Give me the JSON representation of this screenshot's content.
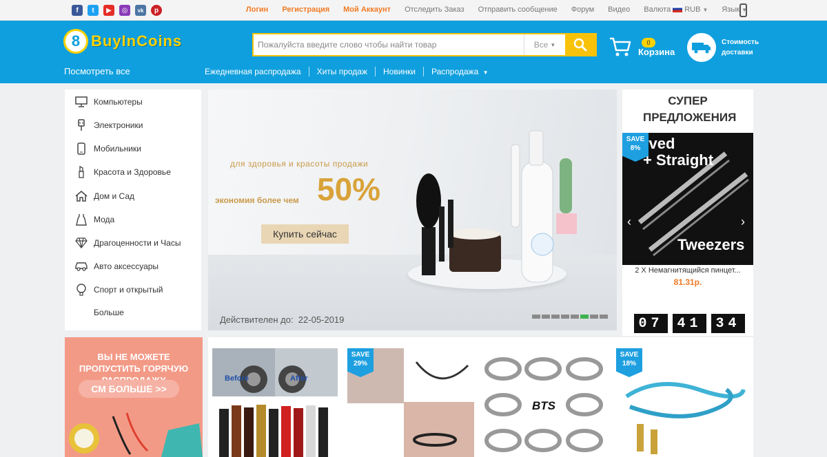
{
  "social": [
    "f",
    "t",
    "▶",
    "◎",
    "vk",
    "p"
  ],
  "topbar": {
    "login": "Логин",
    "register": "Регистрация",
    "account": "Мой Аккаунт",
    "track": "Отследить Заказ",
    "message": "Отправить сообщение",
    "forum": "Форум",
    "video": "Видео",
    "currency_label": "Валюта",
    "currency_value": "RUB",
    "language": "Язык"
  },
  "header": {
    "logo_mark": "8",
    "logo_text": "BuyInCoins",
    "search_placeholder": "Пожалуйста введите слово чтобы найти товар",
    "search_category": "Все",
    "cart_count": "0",
    "cart_label": "Корзина",
    "shipping_label": "Стоимость доставки",
    "view_all": "Посмотреть все"
  },
  "nav": [
    "Ежедневная распродажа",
    "Хиты продаж",
    "Новинки",
    "Распродажа"
  ],
  "categories": [
    {
      "label": "Компьютеры",
      "icon": "monitor-icon"
    },
    {
      "label": "Электроники",
      "icon": "plug-icon"
    },
    {
      "label": "Мобильники",
      "icon": "mobile-icon"
    },
    {
      "label": "Красота и Здоровье",
      "icon": "lipstick-icon"
    },
    {
      "label": "Дом и Сад",
      "icon": "home-icon"
    },
    {
      "label": "Мода",
      "icon": "dress-icon"
    },
    {
      "label": "Драгоценности и Часы",
      "icon": "diamond-icon"
    },
    {
      "label": "Авто аксессуары",
      "icon": "car-icon"
    },
    {
      "label": "Спорт и открытый",
      "icon": "sport-icon"
    },
    {
      "label": "Больше",
      "icon": ""
    }
  ],
  "banner": {
    "subtitle": "для здоровья и красоты продажи",
    "save_text": "экономия более чем",
    "percent": "50%",
    "cta": "Купить сейчас",
    "valid_label": "Действителен до:",
    "valid_date": "22-05-2019",
    "slides": 8,
    "active_slide": 5
  },
  "offers": {
    "title": "СУПЕР ПРЕДЛОЖЕНИЯ",
    "badge_save": "SAVE",
    "badge_pct": "8%",
    "img_text_top": "rved\n+ Straight",
    "img_text_bottom": "Tweezers",
    "product_name": "2 X Немагнитящийся пинцет...",
    "price": "81.31р.",
    "timer": [
      "07",
      "41",
      "34"
    ]
  },
  "promo": {
    "title": "ВЫ НЕ МОЖЕТЕ ПРОПУСТИТЬ ГОРЯЧУЮ РАСПРОДАЖУ",
    "button": "СМ БОЛЬШЕ >>"
  },
  "products": {
    "before": "Before",
    "after": "After",
    "save1": "SAVE",
    "pct1": "29%",
    "save2": "SAVE",
    "pct2": "18%",
    "ring_text": "BTS"
  },
  "colors": {
    "brand_blue": "#0f9fde",
    "accent_yellow": "#f9c20a",
    "link_orange": "#f07a23"
  }
}
